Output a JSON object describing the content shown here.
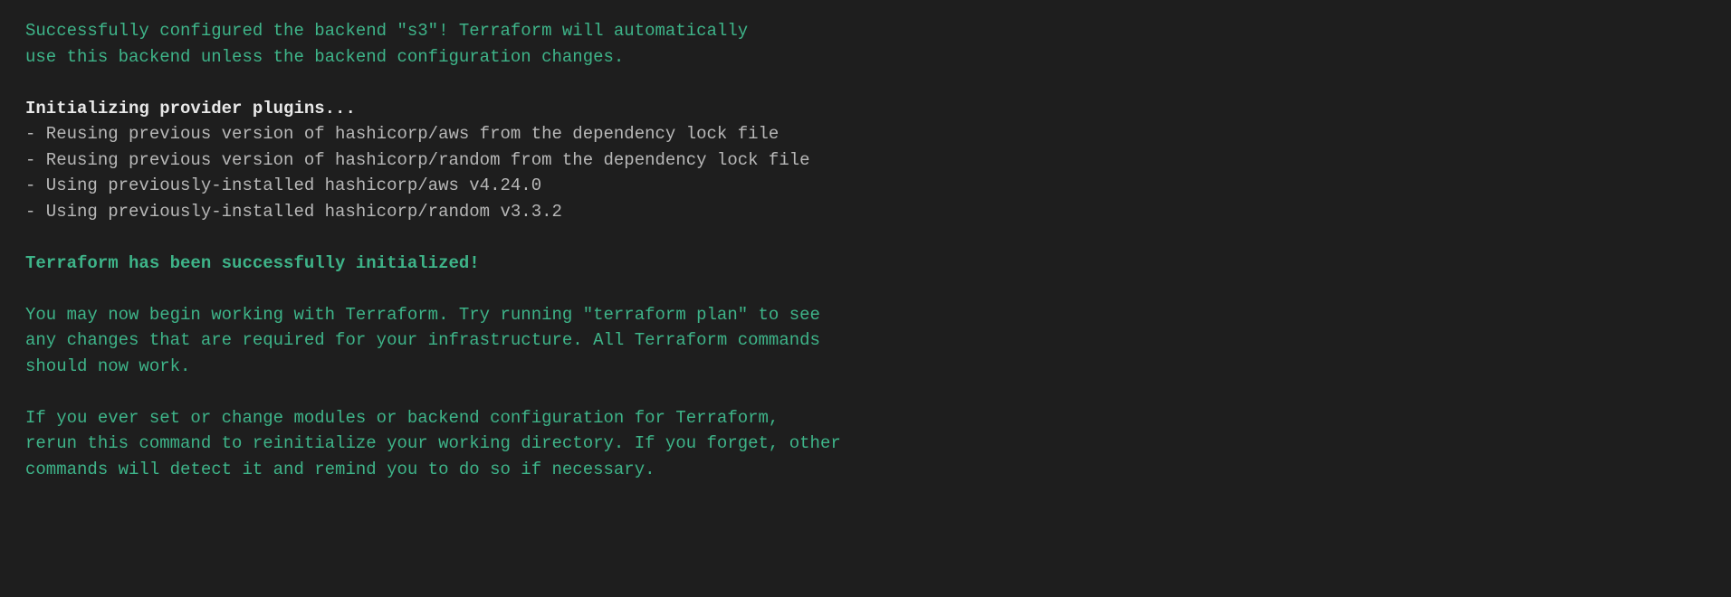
{
  "terminal": {
    "backend_msg_line1": "Successfully configured the backend \"s3\"! Terraform will automatically",
    "backend_msg_line2": "use this backend unless the backend configuration changes.",
    "init_plugins_header": "Initializing provider plugins...",
    "plugin_lines": [
      "- Reusing previous version of hashicorp/aws from the dependency lock file",
      "- Reusing previous version of hashicorp/random from the dependency lock file",
      "- Using previously-installed hashicorp/aws v4.24.0",
      "- Using previously-installed hashicorp/random v3.3.2"
    ],
    "success_header": "Terraform has been successfully initialized!",
    "advice_line1": "You may now begin working with Terraform. Try running \"terraform plan\" to see",
    "advice_line2": "any changes that are required for your infrastructure. All Terraform commands",
    "advice_line3": "should now work.",
    "advice_line4": "If you ever set or change modules or backend configuration for Terraform,",
    "advice_line5": "rerun this command to reinitialize your working directory. If you forget, other",
    "advice_line6": "commands will detect it and remind you to do so if necessary."
  }
}
